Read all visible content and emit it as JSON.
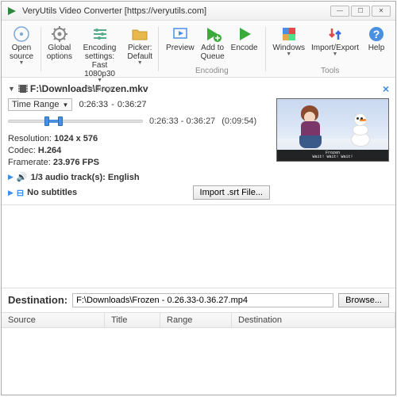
{
  "window": {
    "title": "VeryUtils Video Converter [https://veryutils.com]"
  },
  "toolbar": {
    "open_source": "Open\nsource",
    "global_options": "Global\noptions",
    "encoding_settings": "Encoding settings:\nFast 1080p30",
    "picker": "Picker:\nDefault",
    "preview": "Preview",
    "add_queue": "Add to\nQueue",
    "encode": "Encode",
    "windows": "Windows",
    "import_export": "Import/Export",
    "help": "Help",
    "group_settings": "Settings",
    "group_encoding": "Encoding",
    "group_tools": "Tools"
  },
  "file": {
    "path": "F:\\Downloads\\Frozen.mkv",
    "mode": "Time Range",
    "start_label": "0:26:33",
    "sep": "-",
    "end_label": "0:36:27",
    "range_display": "0:26:33 - 0:36:27",
    "duration": "(0:09:54)",
    "res_label": "Resolution:",
    "res_value": "1024 x 576",
    "codec_label": "Codec:",
    "codec_value": "H.264",
    "fps_label": "Framerate:",
    "fps_value": "23.976 FPS",
    "audio_tracks": "1/3 audio track(s): English",
    "subtitles": "No subtitles",
    "import_srt": "Import .srt File...",
    "preview_sub1": "Frozen",
    "preview_sub2": "Wait! Wait! Wait!"
  },
  "destination": {
    "label": "Destination:",
    "path": "F:\\Downloads\\Frozen - 0.26.33-0.36.27.mp4",
    "browse": "Browse..."
  },
  "queue": {
    "col_source": "Source",
    "col_title": "Title",
    "col_range": "Range",
    "col_destination": "Destination"
  }
}
